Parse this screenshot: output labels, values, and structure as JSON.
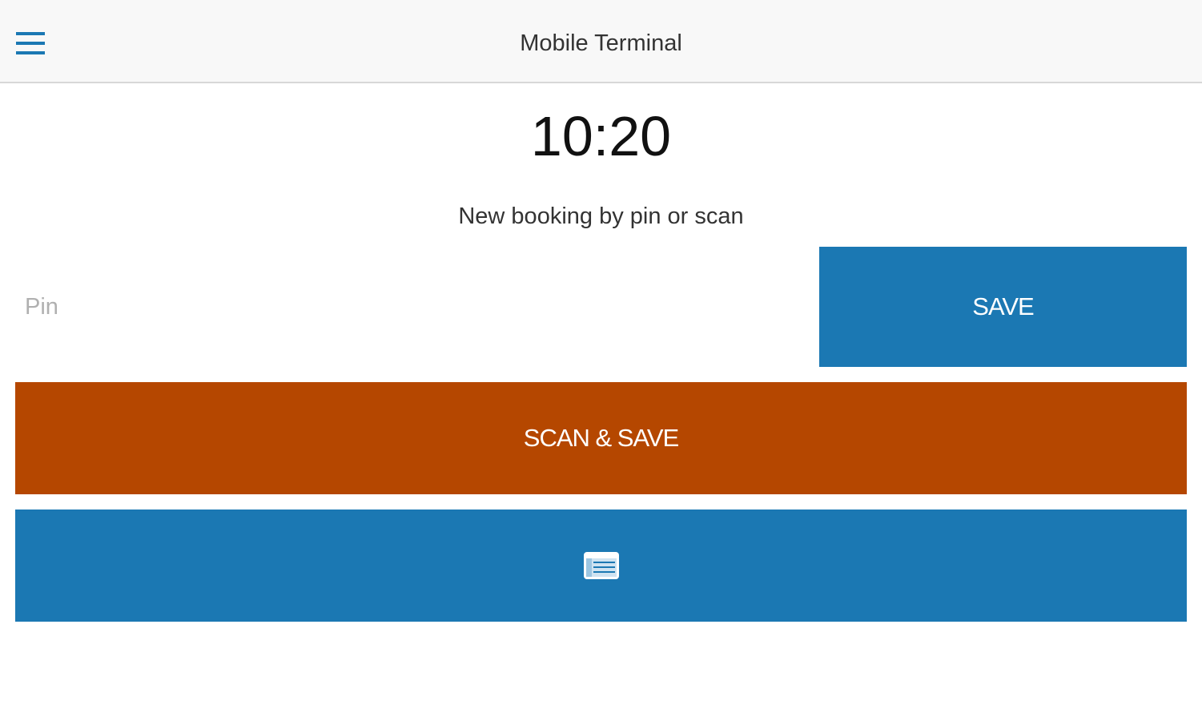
{
  "app_bar": {
    "title": "Mobile Terminal",
    "menu_icon": "hamburger-menu-icon"
  },
  "main": {
    "time": "10:20",
    "subtitle": "New booking by pin or scan",
    "pin": {
      "placeholder": "Pin",
      "value": ""
    },
    "save_label": "SAVE",
    "scan_save_label": "SCAN & SAVE",
    "list_icon": "list-card-icon"
  },
  "colors": {
    "primary": "#1b78b3",
    "accent": "#b54700",
    "app_bar_bg": "#f8f8f8"
  }
}
